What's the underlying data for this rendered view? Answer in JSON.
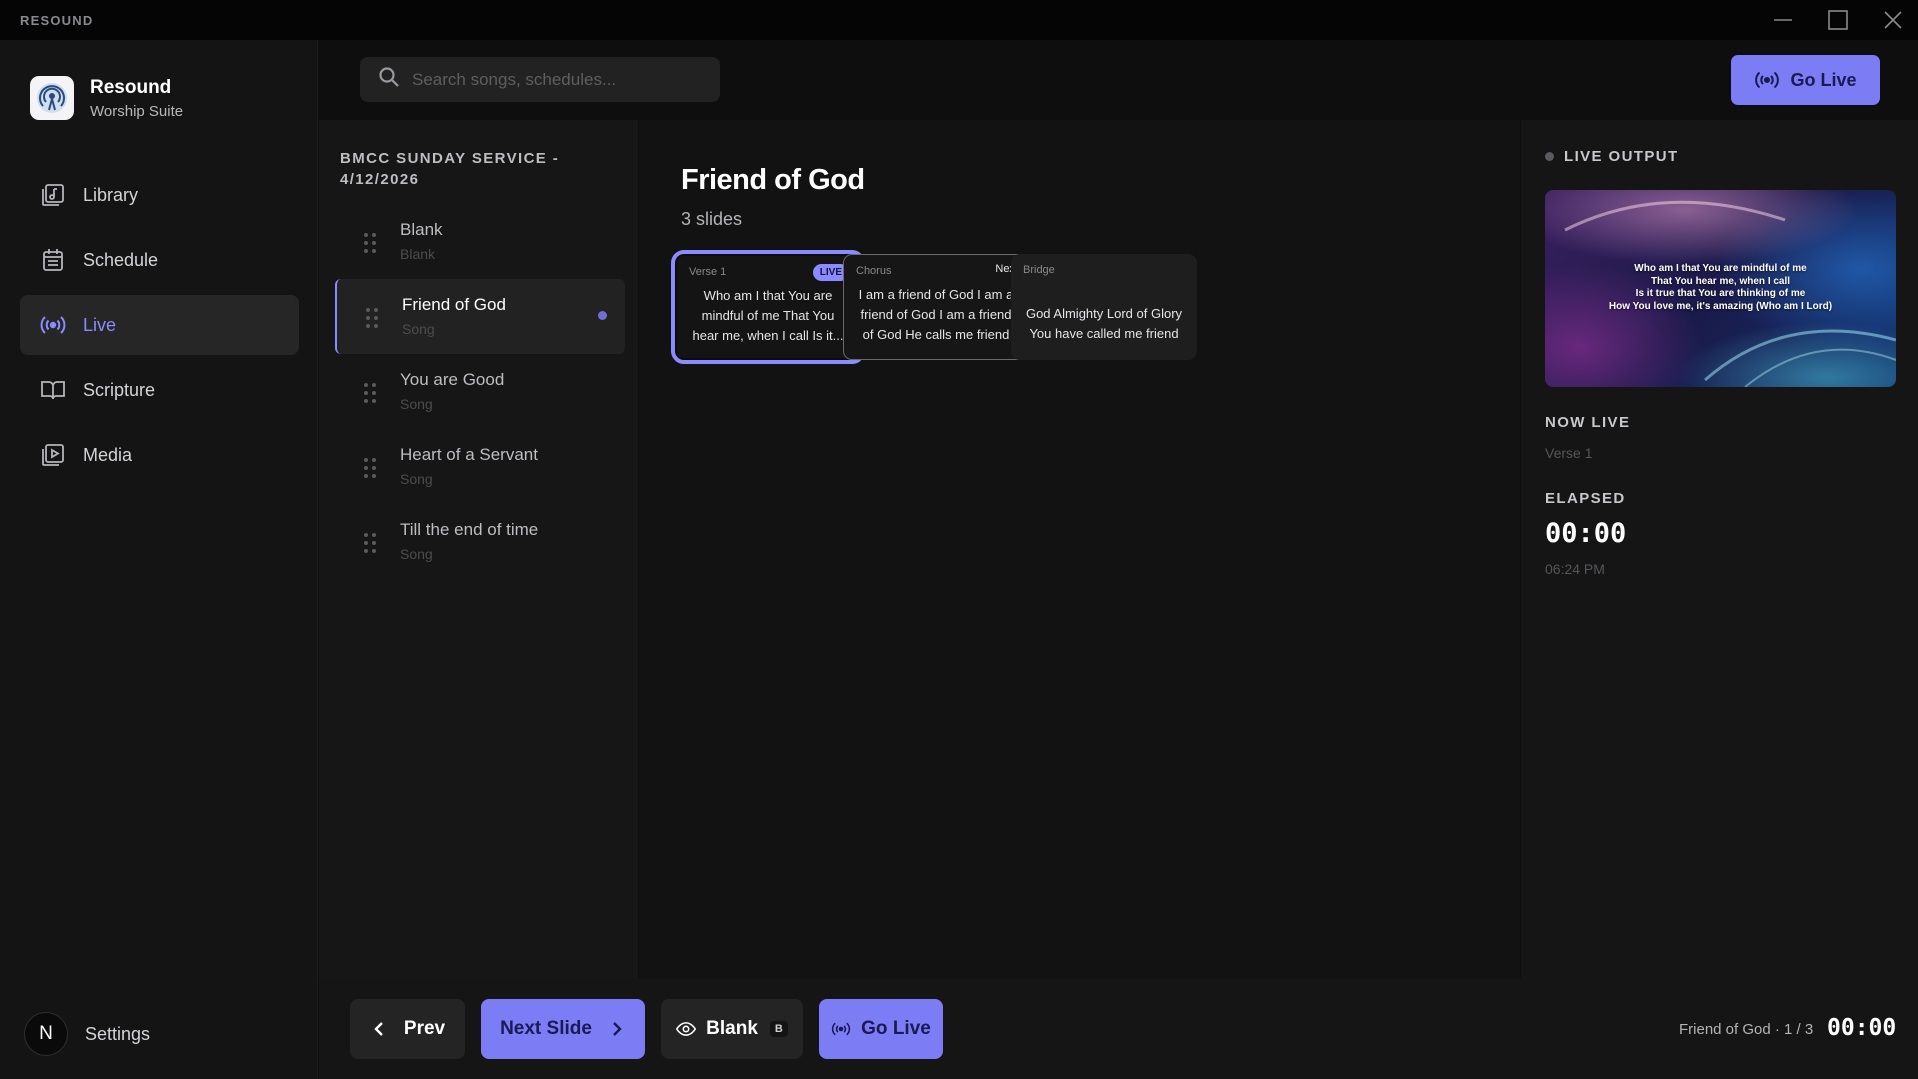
{
  "app": {
    "title": "RESOUND"
  },
  "brand": {
    "name": "Resound",
    "subtitle": "Worship Suite"
  },
  "nav": {
    "items": [
      {
        "label": "Library",
        "icon": "library-icon",
        "active": false
      },
      {
        "label": "Schedule",
        "icon": "calendar-icon",
        "active": false
      },
      {
        "label": "Live",
        "icon": "broadcast-icon",
        "active": true
      },
      {
        "label": "Scripture",
        "icon": "book-icon",
        "active": false
      },
      {
        "label": "Media",
        "icon": "media-icon",
        "active": false
      }
    ],
    "settings": {
      "avatar": "N",
      "label": "Settings"
    }
  },
  "search": {
    "placeholder": "Search songs, schedules..."
  },
  "top": {
    "go_live_label": "Go Live"
  },
  "schedule": {
    "title": "BMCC SUNDAY SERVICE - 4/12/2026",
    "items": [
      {
        "name": "Blank",
        "type": "Blank"
      },
      {
        "name": "Friend of God",
        "type": "Song"
      },
      {
        "name": "You are Good",
        "type": "Song"
      },
      {
        "name": "Heart of a Servant",
        "type": "Song"
      },
      {
        "name": "Till the end of time",
        "type": "Song"
      }
    ]
  },
  "song": {
    "title": "Friend of God",
    "slide_count": "3 slides",
    "slides": [
      {
        "label": "Verse 1",
        "badge": "LIVE",
        "text": "Who am I that You are mindful of me That You hear me, when I call Is it..."
      },
      {
        "label": "Chorus",
        "badge": "Next",
        "text": "I am a friend of God I am a friend of God I am a friend of God He calls me friend"
      },
      {
        "label": "Bridge",
        "badge": "",
        "text": "God Almighty Lord of Glory You have called me friend"
      }
    ]
  },
  "live_panel": {
    "header": "LIVE OUTPUT",
    "preview_lines": [
      "Who am I that You are mindful of me",
      "That You hear me, when I call",
      "Is it true that You are thinking of me",
      "How You love me, it's amazing (Who am I Lord)"
    ],
    "now_live_header": "NOW LIVE",
    "now_live_value": "Verse 1",
    "elapsed_header": "ELAPSED",
    "elapsed_value": "00:00",
    "clock": "06:24 PM"
  },
  "bottom": {
    "prev_label": "Prev",
    "next_label": "Next Slide",
    "blank_label": "Blank",
    "blank_key": "B",
    "go_live_label": "Go Live",
    "status": "Friend of God · 1 / 3",
    "time": "00:00"
  },
  "colors": {
    "accent": "#7c7cf5",
    "accent_text": "#8b8bff",
    "background": "#0e0e0e"
  }
}
